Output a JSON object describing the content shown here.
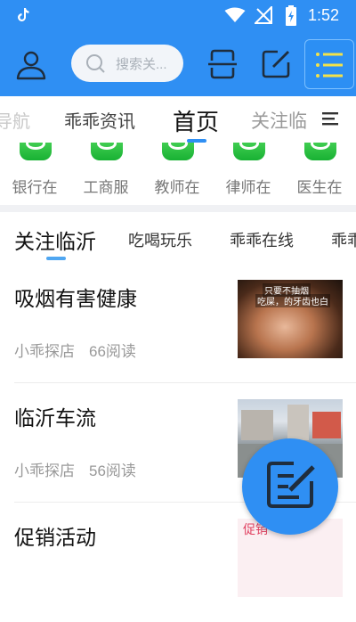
{
  "status_bar": {
    "time": "1:52"
  },
  "header": {
    "search_placeholder": "搜索关..."
  },
  "tabs": [
    {
      "label": "导航"
    },
    {
      "label": "乖乖资讯"
    },
    {
      "label": "首页"
    },
    {
      "label": "关注临"
    }
  ],
  "shortcuts": [
    {
      "label": "银行在"
    },
    {
      "label": "工商服"
    },
    {
      "label": "教师在"
    },
    {
      "label": "律师在"
    },
    {
      "label": "医生在"
    }
  ],
  "subtabs": [
    {
      "label": "关注临沂"
    },
    {
      "label": "吃喝玩乐"
    },
    {
      "label": "乖乖在线"
    },
    {
      "label": "乖乖"
    }
  ],
  "articles": [
    {
      "title": "吸烟有害健康",
      "author": "小乖探店",
      "reads": "66阅读",
      "thumb_caption_1": "只要不抽烟",
      "thumb_caption_2": "吃屎，的牙齿也白"
    },
    {
      "title": "临沂车流",
      "author": "小乖探店",
      "reads": "56阅读"
    },
    {
      "title": "促销活动",
      "thumb_text": "促销"
    }
  ],
  "colors": {
    "brand": "#2f8ff3",
    "shortcut_green": "#18b133",
    "indicator": "#4fa6f1"
  }
}
